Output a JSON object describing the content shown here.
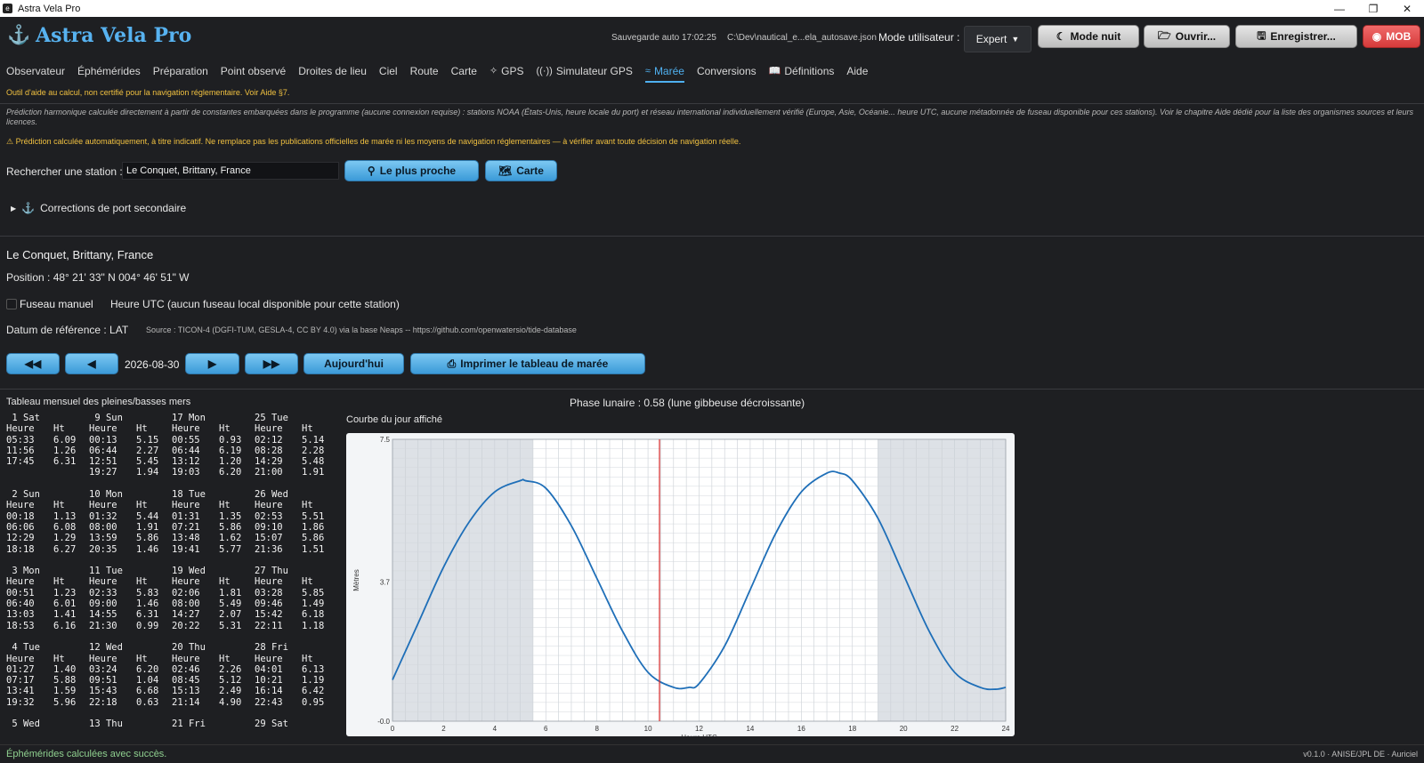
{
  "window": {
    "title": "Astra Vela Pro"
  },
  "header": {
    "brand": "Astra Vela Pro",
    "autosave": "Sauvegarde auto 17:02:25",
    "autosave_path": "C:\\Dev\\nautical_e...ela_autosave.json",
    "mode_label": "Mode utilisateur :",
    "mode_value": "Expert",
    "buttons": {
      "night": "Mode nuit",
      "open": "Ouvrir...",
      "save": "Enregistrer...",
      "mob": "MOB"
    }
  },
  "nav": {
    "tabs": [
      {
        "label": "Observateur"
      },
      {
        "label": "Éphémérides"
      },
      {
        "label": "Préparation"
      },
      {
        "label": "Point observé"
      },
      {
        "label": "Droites de lieu"
      },
      {
        "label": "Ciel"
      },
      {
        "label": "Route"
      },
      {
        "label": "Carte"
      },
      {
        "label": "GPS"
      },
      {
        "label": "Simulateur GPS"
      },
      {
        "label": "Marée"
      },
      {
        "label": "Conversions"
      },
      {
        "label": "Définitions"
      },
      {
        "label": "Aide"
      }
    ]
  },
  "notice": "Outil d'aide au calcul, non certifié pour la navigation réglementaire. Voir Aide §7.",
  "tide_note": "Prédiction harmonique calculée directement à partir de constantes embarquées dans le programme (aucune connexion requise) : stations NOAA (États-Unis, heure locale du port) et réseau international individuellement vérifié (Europe, Asie, Océanie... heure UTC, aucune métadonnée de fuseau disponible pour ces stations). Voir le chapitre Aide dédié pour la liste des organismes sources et leurs licences.",
  "warning": "⚠ Prédiction calculée automatiquement, à titre indicatif. Ne remplace pas les publications officielles de marée ni les moyens de navigation réglementaires — à vérifier avant toute décision de navigation réelle.",
  "search": {
    "label": "Rechercher une station :",
    "value": "Le Conquet, Brittany, France",
    "nearest_btn": "Le plus proche",
    "map_btn": "Carte"
  },
  "corrections": "Corrections de port secondaire",
  "station": {
    "name": "Le Conquet, Brittany, France",
    "position": "Position : 48° 21' 33\" N   004° 46' 51\" W",
    "manual_tz_label": "Fuseau manuel",
    "utc_note": "Heure UTC (aucun fuseau local disponible pour cette station)",
    "datum": "Datum de référence : LAT",
    "source": "Source : TICON-4 (DGFI-TUM, GESLA-4, CC BY 4.0) via la base Neaps -- https://github.com/openwatersio/tide-database"
  },
  "date_nav": {
    "date": "2026-08-30",
    "today_btn": "Aujourd'hui",
    "print_btn": "Imprimer le tableau de marée",
    "prev_month": "◀◀",
    "prev_day": "◀",
    "next_day": "▶",
    "next_month": "▶▶"
  },
  "tide_table": {
    "title": "Tableau mensuel des pleines/basses mers",
    "col_heure": "Heure",
    "col_ht": "Ht",
    "blocks": [
      {
        "days": [
          {
            "title": " 1 Sat",
            "rows": [
              [
                "05:33",
                "6.09"
              ],
              [
                "11:56",
                "1.26"
              ],
              [
                "17:45",
                "6.31"
              ]
            ]
          },
          {
            "title": " 9 Sun",
            "rows": [
              [
                "00:13",
                "5.15"
              ],
              [
                "06:44",
                "2.27"
              ],
              [
                "12:51",
                "5.45"
              ],
              [
                "19:27",
                "1.94"
              ]
            ]
          },
          {
            "title": "17 Mon",
            "rows": [
              [
                "00:55",
                "0.93"
              ],
              [
                "06:44",
                "6.19"
              ],
              [
                "13:12",
                "1.20"
              ],
              [
                "19:03",
                "6.20"
              ]
            ]
          },
          {
            "title": "25 Tue",
            "rows": [
              [
                "02:12",
                "5.14"
              ],
              [
                "08:28",
                "2.28"
              ],
              [
                "14:29",
                "5.48"
              ],
              [
                "21:00",
                "1.91"
              ]
            ]
          }
        ]
      },
      {
        "days": [
          {
            "title": " 2 Sun",
            "rows": [
              [
                "00:18",
                "1.13"
              ],
              [
                "06:06",
                "6.08"
              ],
              [
                "12:29",
                "1.29"
              ],
              [
                "18:18",
                "6.27"
              ]
            ]
          },
          {
            "title": "10 Mon",
            "rows": [
              [
                "01:32",
                "5.44"
              ],
              [
                "08:00",
                "1.91"
              ],
              [
                "13:59",
                "5.86"
              ],
              [
                "20:35",
                "1.46"
              ]
            ]
          },
          {
            "title": "18 Tue",
            "rows": [
              [
                "01:31",
                "1.35"
              ],
              [
                "07:21",
                "5.86"
              ],
              [
                "13:48",
                "1.62"
              ],
              [
                "19:41",
                "5.77"
              ]
            ]
          },
          {
            "title": "26 Wed",
            "rows": [
              [
                "02:53",
                "5.51"
              ],
              [
                "09:10",
                "1.86"
              ],
              [
                "15:07",
                "5.86"
              ],
              [
                "21:36",
                "1.51"
              ]
            ]
          }
        ]
      },
      {
        "days": [
          {
            "title": " 3 Mon",
            "rows": [
              [
                "00:51",
                "1.23"
              ],
              [
                "06:40",
                "6.01"
              ],
              [
                "13:03",
                "1.41"
              ],
              [
                "18:53",
                "6.16"
              ]
            ]
          },
          {
            "title": "11 Tue",
            "rows": [
              [
                "02:33",
                "5.83"
              ],
              [
                "09:00",
                "1.46"
              ],
              [
                "14:55",
                "6.31"
              ],
              [
                "21:30",
                "0.99"
              ]
            ]
          },
          {
            "title": "19 Wed",
            "rows": [
              [
                "02:06",
                "1.81"
              ],
              [
                "08:00",
                "5.49"
              ],
              [
                "14:27",
                "2.07"
              ],
              [
                "20:22",
                "5.31"
              ]
            ]
          },
          {
            "title": "27 Thu",
            "rows": [
              [
                "03:28",
                "5.85"
              ],
              [
                "09:46",
                "1.49"
              ],
              [
                "15:42",
                "6.18"
              ],
              [
                "22:11",
                "1.18"
              ]
            ]
          }
        ]
      },
      {
        "days": [
          {
            "title": " 4 Tue",
            "rows": [
              [
                "01:27",
                "1.40"
              ],
              [
                "07:17",
                "5.88"
              ],
              [
                "13:41",
                "1.59"
              ],
              [
                "19:32",
                "5.96"
              ]
            ]
          },
          {
            "title": "12 Wed",
            "rows": [
              [
                "03:24",
                "6.20"
              ],
              [
                "09:51",
                "1.04"
              ],
              [
                "15:43",
                "6.68"
              ],
              [
                "22:18",
                "0.63"
              ]
            ]
          },
          {
            "title": "20 Thu",
            "rows": [
              [
                "02:46",
                "2.26"
              ],
              [
                "08:45",
                "5.12"
              ],
              [
                "15:13",
                "2.49"
              ],
              [
                "21:14",
                "4.90"
              ]
            ]
          },
          {
            "title": "28 Fri",
            "rows": [
              [
                "04:01",
                "6.13"
              ],
              [
                "10:21",
                "1.19"
              ],
              [
                "16:14",
                "6.42"
              ],
              [
                "22:43",
                "0.95"
              ]
            ]
          }
        ]
      },
      {
        "days": [
          {
            "title": " 5 Wed",
            "rows": []
          },
          {
            "title": "13 Thu",
            "rows": []
          },
          {
            "title": "21 Fri",
            "rows": []
          },
          {
            "title": "29 Sat",
            "rows": []
          }
        ]
      }
    ]
  },
  "phase": "Phase lunaire : 0.58 (lune gibbeuse décroissante)",
  "chart_title": "Courbe du jour affiché",
  "chart_data": {
    "type": "line",
    "title": "",
    "xlabel": "Heure UTC",
    "ylabel": "Mètres",
    "xlim": [
      0,
      24
    ],
    "ylim": [
      0,
      7.5
    ],
    "xticks": [
      "0",
      "2",
      "4",
      "6",
      "8",
      "10",
      "12",
      "14",
      "16",
      "18",
      "20",
      "22",
      "24"
    ],
    "yticks": [
      "-0.0",
      "3.7",
      "7.5"
    ],
    "current_time_hour": 10.45,
    "night_shading_hours": [
      [
        0,
        5.5
      ],
      [
        19,
        24
      ]
    ],
    "series": [
      {
        "x": [
          0,
          1,
          2,
          3,
          4,
          5,
          5.2,
          6,
          7,
          8,
          9,
          10,
          11,
          11.6,
          12,
          13,
          14,
          15,
          16,
          17,
          17.5,
          18,
          19,
          20,
          21,
          22,
          23,
          23.6,
          24
        ],
        "y": [
          1.1,
          2.6,
          4.1,
          5.3,
          6.1,
          6.4,
          6.4,
          6.2,
          5.2,
          3.8,
          2.4,
          1.3,
          0.9,
          0.9,
          1.0,
          2.0,
          3.5,
          5.0,
          6.1,
          6.6,
          6.6,
          6.4,
          5.4,
          3.9,
          2.4,
          1.3,
          0.9,
          0.85,
          0.9
        ]
      }
    ],
    "line_color": "#1f6fb8",
    "current_time_color": "#d62828"
  },
  "status": {
    "left": "Éphémérides calculées avec succès.",
    "right": "v0.1.0 · ANISE/JPL DE · Auriciel"
  }
}
